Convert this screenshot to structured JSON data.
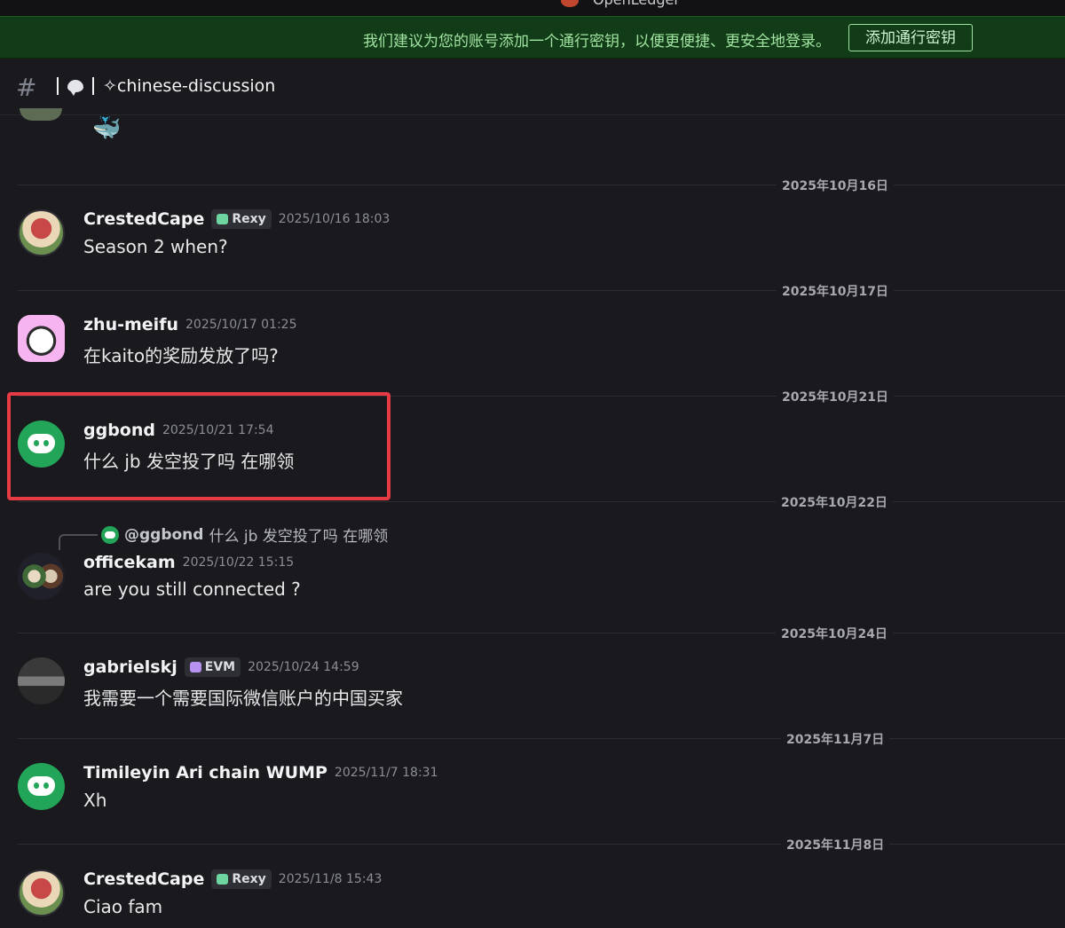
{
  "window": {
    "title": "OpenLedger"
  },
  "notice": {
    "text": "我们建议为您的账号添加一个通行密钥，以便更便捷、更安全地登录。",
    "button_label": "添加通行密钥"
  },
  "channel": {
    "name": "✧chinese-discussion"
  },
  "dividers": [
    "2025年10月16日",
    "2025年10月17日",
    "2025年10月21日",
    "2025年10月22日",
    "2025年10月24日",
    "2025年11月7日",
    "2025年11月8日"
  ],
  "messages": [
    {
      "username": "CrestedCape",
      "tag": "Rexy",
      "timestamp": "2025/10/16 18:03",
      "text": "Season 2 when?"
    },
    {
      "username": "zhu-meifu",
      "timestamp": "2025/10/17 01:25",
      "text": "在kaito的奖励发放了吗?"
    },
    {
      "username": "ggbond",
      "timestamp": "2025/10/21 17:54",
      "text": "什么 jb 发空投了吗 在哪领"
    },
    {
      "reply_user": "@ggbond",
      "reply_text": "什么 jb 发空投了吗 在哪领",
      "username": "officekam",
      "timestamp": "2025/10/22 15:15",
      "text": "are you still connected ?"
    },
    {
      "username": "gabrielskj",
      "tag": "EVM",
      "timestamp": "2025/10/24 14:59",
      "text": "我需要一个需要国际微信账户的中国买家"
    },
    {
      "username": "Timileyin Ari chain WUMP",
      "timestamp": "2025/11/7 18:31",
      "text": "Xh"
    },
    {
      "username": "CrestedCape",
      "tag": "Rexy",
      "timestamp": "2025/11/8 15:43",
      "text": "Ciao fam"
    }
  ],
  "colors": {
    "accent_green": "#23a559",
    "highlight_red": "#e63b45",
    "rexy_heart": "#6fd5a0",
    "evm_heart": "#b892f0"
  },
  "icons": {
    "channel": "hash-icon",
    "channel_emoji": "speech-bubble-icon",
    "whale": "whale-emoji-icon"
  }
}
